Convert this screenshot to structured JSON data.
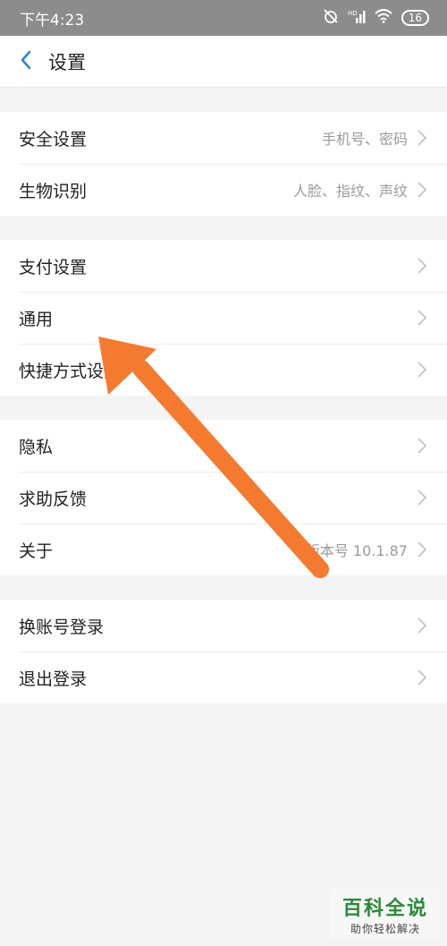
{
  "status_bar": {
    "time": "下午4:23",
    "icons": [
      "alarm-off-icon",
      "hd-signal-icon",
      "wifi-icon"
    ],
    "battery": "16"
  },
  "navbar": {
    "title": "设置",
    "back_icon": "chevron-left-icon"
  },
  "groups": [
    {
      "items": [
        {
          "label": "安全设置",
          "value": "手机号、密码"
        },
        {
          "label": "生物识别",
          "value": "人脸、指纹、声纹"
        }
      ]
    },
    {
      "items": [
        {
          "label": "支付设置",
          "value": ""
        },
        {
          "label": "通用",
          "value": ""
        },
        {
          "label": "快捷方式设置",
          "value": ""
        }
      ]
    },
    {
      "items": [
        {
          "label": "隐私",
          "value": ""
        },
        {
          "label": "求助反馈",
          "value": ""
        },
        {
          "label": "关于",
          "value": "版本号 10.1.87"
        }
      ]
    },
    {
      "items": [
        {
          "label": "换账号登录",
          "value": ""
        },
        {
          "label": "退出登录",
          "value": ""
        }
      ]
    }
  ],
  "annotation": {
    "arrow_color": "#f47a30"
  },
  "watermark": {
    "title": "百科全说",
    "subtitle": "助你轻松解决"
  },
  "colors": {
    "accent": "#2a88d8",
    "status_bar": "#8c8c8c"
  }
}
